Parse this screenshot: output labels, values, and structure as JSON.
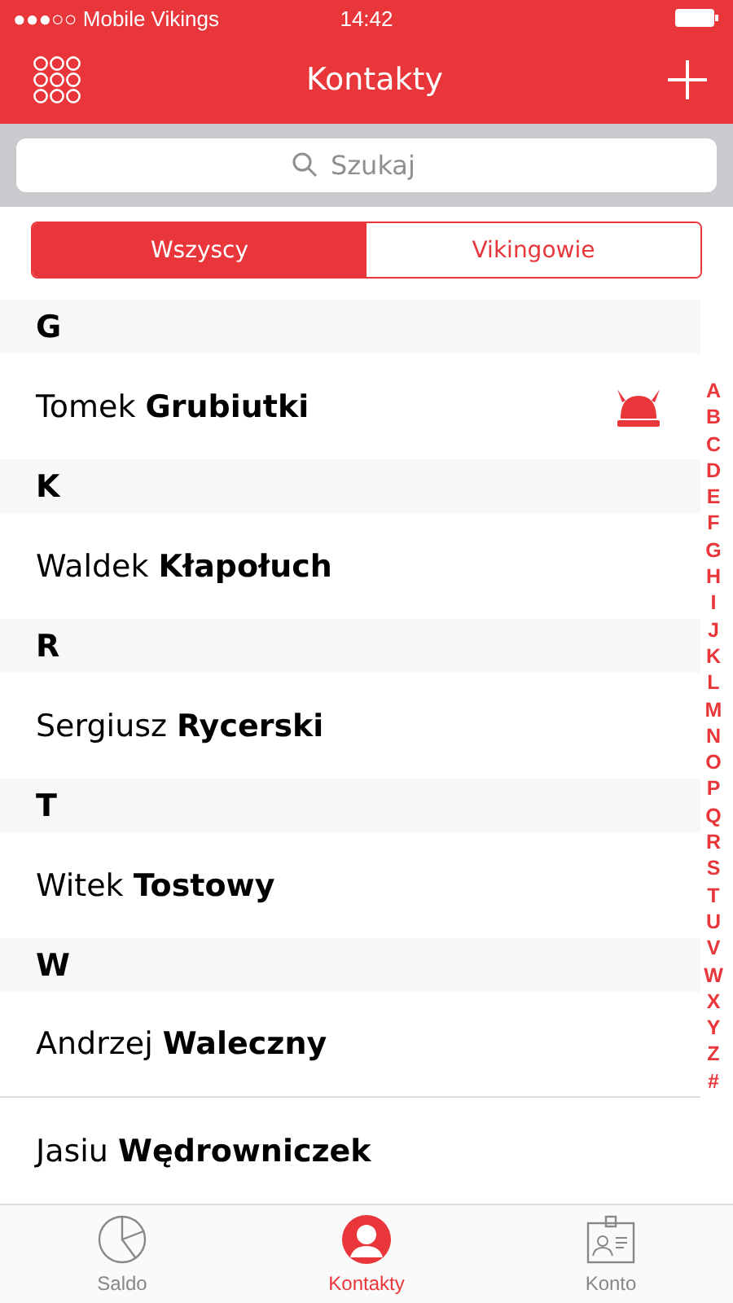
{
  "status_bar": {
    "signal": "●●●○○",
    "carrier": "Mobile Vikings",
    "time": "14:42"
  },
  "nav": {
    "title": "Kontakty"
  },
  "search": {
    "placeholder": "Szukaj"
  },
  "segments": [
    {
      "label": "Wszyscy",
      "selected": true
    },
    {
      "label": "Vikingowie",
      "selected": false
    }
  ],
  "sections": [
    {
      "letter": "G",
      "contacts": [
        {
          "first": "Tomek",
          "last": "Grubiutki",
          "viking": true
        }
      ]
    },
    {
      "letter": "K",
      "contacts": [
        {
          "first": "Waldek",
          "last": "Kłapołuch",
          "viking": false
        }
      ]
    },
    {
      "letter": "R",
      "contacts": [
        {
          "first": "Sergiusz",
          "last": "Rycerski",
          "viking": false
        }
      ]
    },
    {
      "letter": "T",
      "contacts": [
        {
          "first": "Witek",
          "last": "Tostowy",
          "viking": false
        }
      ]
    },
    {
      "letter": "W",
      "contacts": [
        {
          "first": "Andrzej",
          "last": "Waleczny",
          "viking": false
        },
        {
          "first": "Jasiu",
          "last": "Wędrowniczek",
          "viking": false
        }
      ]
    }
  ],
  "index": [
    "A",
    "B",
    "C",
    "D",
    "E",
    "F",
    "G",
    "H",
    "I",
    "J",
    "K",
    "L",
    "M",
    "N",
    "O",
    "P",
    "Q",
    "R",
    "S",
    "T",
    "U",
    "V",
    "W",
    "X",
    "Y",
    "Z",
    "#"
  ],
  "tab_bar": [
    {
      "label": "Saldo",
      "kind": "chart",
      "selected": false
    },
    {
      "label": "Kontakty",
      "kind": "person",
      "selected": true
    },
    {
      "label": "Konto",
      "kind": "card",
      "selected": false
    }
  ]
}
